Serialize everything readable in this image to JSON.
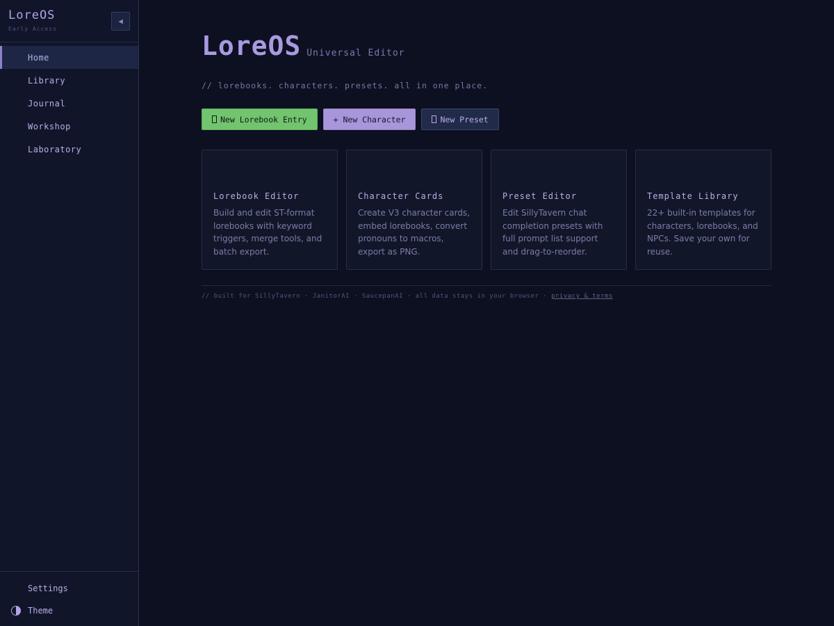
{
  "sidebar": {
    "brand_title": "LoreOS",
    "brand_subtitle": "Early Access",
    "collapse_icon": "triangle-left-icon",
    "nav": [
      {
        "label": "Home",
        "active": true
      },
      {
        "label": "Library"
      },
      {
        "label": "Journal"
      },
      {
        "label": "Workshop"
      },
      {
        "label": "Laboratory"
      }
    ],
    "settings_label": "Settings",
    "theme_label": "Theme",
    "theme_icon": "half-circle-icon"
  },
  "hero": {
    "title": "LoreOS",
    "subtitle": "Universal Editor",
    "tagline": "// lorebooks. characters. presets. all in one place."
  },
  "buttons": {
    "new_lorebook": "New Lorebook Entry",
    "new_character": "+ New Character",
    "new_preset": "New Preset"
  },
  "cards": [
    {
      "title": "Lorebook Editor",
      "desc": "Build and edit ST-format lorebooks with keyword triggers, merge tools, and batch export."
    },
    {
      "title": "Character Cards",
      "desc": "Create V3 character cards, embed lorebooks, convert pronouns to macros, export as PNG."
    },
    {
      "title": "Preset Editor",
      "desc": "Edit SillyTavern chat completion presets with full prompt list support and drag-to-reorder."
    },
    {
      "title": "Template Library",
      "desc": "22+ built-in templates for characters, lorebooks, and NPCs. Save your own for reuse."
    }
  ],
  "footer": {
    "text": "// built for SillyTavern · JanitorAI · SaucepanAI  ·  all data stays in your browser  ·",
    "link": "privacy & terms"
  },
  "colors": {
    "background": "#0d1020",
    "sidebar": "#101529",
    "accent_purple": "#a895da",
    "accent_green": "#72c46f"
  }
}
